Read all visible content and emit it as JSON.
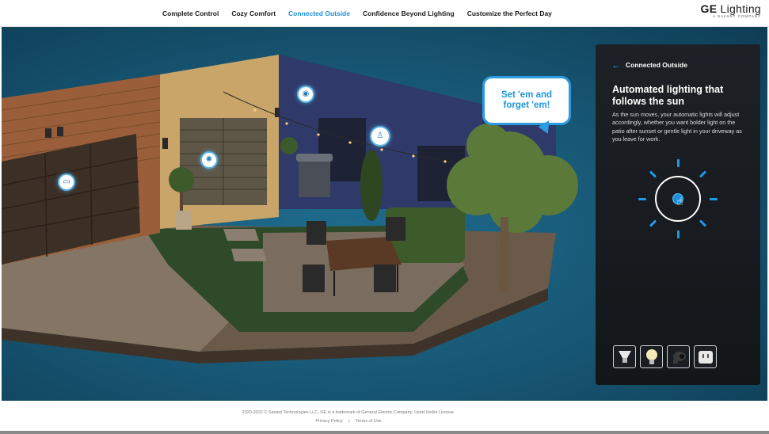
{
  "header": {
    "nav": [
      {
        "label": "Complete Control"
      },
      {
        "label": "Cozy Comfort"
      },
      {
        "label": "Connected Outside"
      },
      {
        "label": "Confidence Beyond Lighting"
      },
      {
        "label": "Customize the Perfect Day"
      }
    ],
    "active_nav": "Connected Outside",
    "logo": {
      "brand": "GE",
      "word": "Lighting",
      "tagline": "A SAVANT COMPANY"
    }
  },
  "scene": {
    "bubble_text": "Set 'em and forget 'em!",
    "hotspots": [
      "garage-controller-icon",
      "patio-light-icon",
      "camera-icon",
      "string-light-icon"
    ]
  },
  "panel": {
    "back_label": "Connected Outside",
    "title": "Automated lighting that follows the sun",
    "body": "As the sun moves, your automatic lights will adjust accordingly, whether you want bolder light on the patio after sunset or gentle light in your driveway as you leave for work.",
    "products": [
      "flood-bulb-icon",
      "bulb-icon",
      "camera-icon",
      "smart-plug-icon"
    ]
  },
  "footer": {
    "copyright": "2020-2022 © Savant Technologies LLC. GE is a trademark of General Electric Company. Used Under License.",
    "privacy": "Privacy Policy",
    "separator": "|",
    "terms": "Terms of Use"
  },
  "colors": {
    "accent": "#1e8fd6",
    "scene_bg": "#175673",
    "panel_bg": "#1a1d21"
  }
}
